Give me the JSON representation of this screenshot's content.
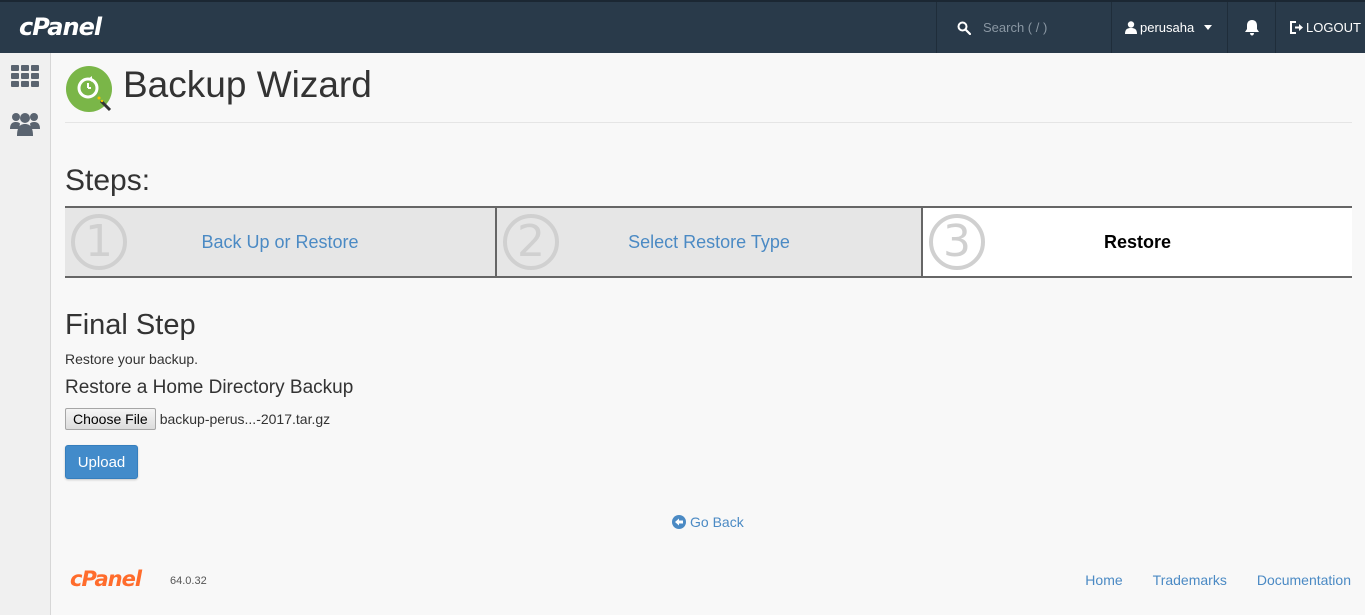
{
  "header": {
    "logo": "cPanel",
    "search_placeholder": "Search ( / )",
    "username": "perusaha",
    "logout_label": "LOGOUT"
  },
  "sidebar": {
    "items": [
      {
        "icon": "apps-grid-icon"
      },
      {
        "icon": "users-icon"
      }
    ]
  },
  "page": {
    "title": "Backup Wizard",
    "steps_heading": "Steps:",
    "steps": [
      {
        "number": "1",
        "label": "Back Up or Restore",
        "state": "done"
      },
      {
        "number": "2",
        "label": "Select Restore Type",
        "state": "done"
      },
      {
        "number": "3",
        "label": "Restore",
        "state": "current"
      }
    ],
    "final_heading": "Final Step",
    "final_desc": "Restore your backup.",
    "restore_heading": "Restore a Home Directory Backup",
    "choose_file_label": "Choose File",
    "file_name": "backup-perus...-2017.tar.gz",
    "upload_label": "Upload",
    "go_back_label": "Go Back"
  },
  "footer": {
    "logo": "cPanel",
    "version": "64.0.32",
    "links": [
      "Home",
      "Trademarks",
      "Documentation"
    ]
  },
  "colors": {
    "topbar": "#293a4a",
    "link": "#4b8ac4",
    "primary_button": "#428bca",
    "brand_orange": "#ff6c2c",
    "icon_green": "#7ab648"
  }
}
